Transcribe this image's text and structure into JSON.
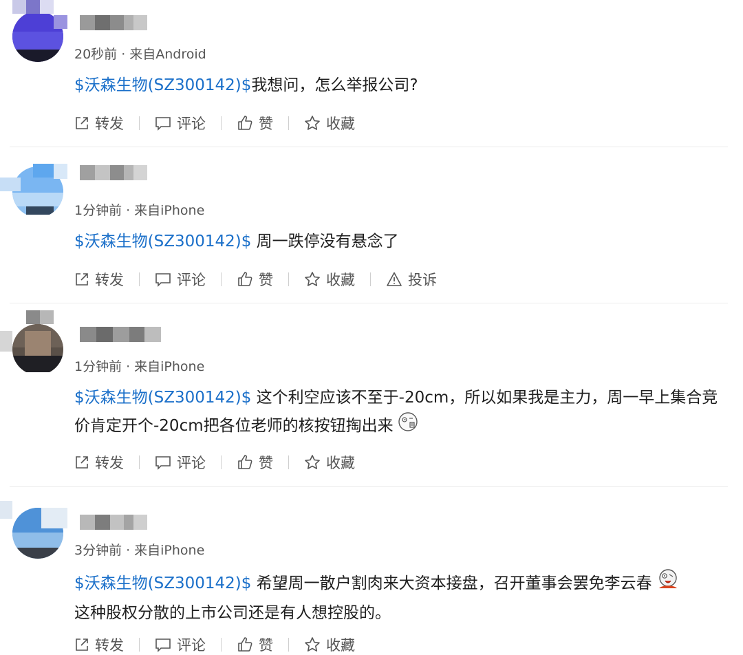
{
  "actions": {
    "repost": "转发",
    "comment": "评论",
    "like": "赞",
    "favorite": "收藏",
    "report": "投诉"
  },
  "posts": [
    {
      "time": "20秒前",
      "source": "来自Android",
      "stock": "$沃森生物(SZ300142)$",
      "text": "我想问，怎么举报公司?",
      "avatar_icon": "avatar-blurred",
      "emoji": ""
    },
    {
      "time": "1分钟前",
      "source": "来自iPhone",
      "stock": "$沃森生物(SZ300142)$",
      "text": " 周一跌停没有悬念了",
      "avatar_icon": "avatar-blurred",
      "emoji": ""
    },
    {
      "time": "1分钟前",
      "source": "来自iPhone",
      "stock": "$沃森生物(SZ300142)$",
      "text": " 这个利空应该不至于-20cm，所以如果我是主力，周一早上集合竞价肯定开个-20cm把各位老师的核按钮掏出来",
      "avatar_icon": "avatar-blurred",
      "emoji": "thinking-face-emoji"
    },
    {
      "time": "3分钟前",
      "source": "来自iPhone",
      "stock": "$沃森生物(SZ300142)$",
      "text": " 希望周一散户割肉来大资本接盘，召开董事会罢免李云春",
      "text2": "这种股权分散的上市公司还是有人想控股的。",
      "avatar_icon": "avatar-blurred",
      "emoji": "bleeding-face-emoji"
    }
  ],
  "colors": {
    "stock_link": "#1a6fc9",
    "text": "#1f1f1f",
    "meta": "#555555",
    "divider": "#ececec"
  }
}
